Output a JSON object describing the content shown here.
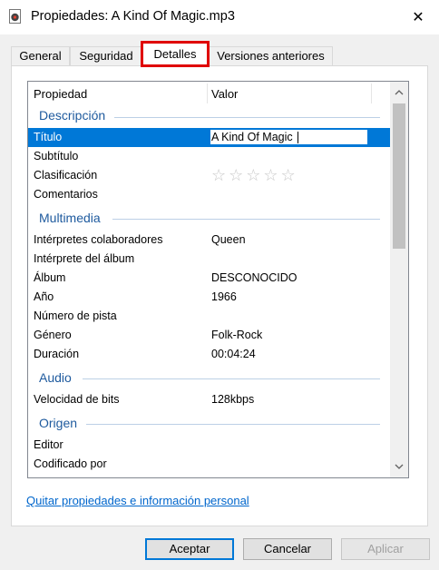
{
  "window": {
    "title": "Propiedades: A Kind Of Magic.mp3",
    "close_glyph": "✕"
  },
  "tabs": [
    {
      "label": "General"
    },
    {
      "label": "Seguridad"
    },
    {
      "label": "Detalles"
    },
    {
      "label": "Versiones anteriores"
    }
  ],
  "active_tab": "Detalles",
  "highlight_color": "#e00000",
  "list": {
    "headers": {
      "property": "Propiedad",
      "value": "Valor"
    },
    "sections": {
      "descripcion": "Descripción",
      "multimedia": "Multimedia",
      "audio": "Audio",
      "origen": "Origen"
    },
    "rows": {
      "titulo": {
        "key": "Título",
        "value": "A Kind Of Magic"
      },
      "subtitulo": {
        "key": "Subtítulo",
        "value": ""
      },
      "clasificacion": {
        "key": "Clasificación",
        "rating": 0,
        "max_rating": 5
      },
      "comentarios": {
        "key": "Comentarios",
        "value": ""
      },
      "interpretes": {
        "key": "Intérpretes colaboradores",
        "value": "Queen"
      },
      "interprete_album": {
        "key": "Intérprete del álbum",
        "value": ""
      },
      "album": {
        "key": "Álbum",
        "value": "DESCONOCIDO"
      },
      "anio": {
        "key": "Año",
        "value": "1966"
      },
      "pista": {
        "key": "Número de pista",
        "value": ""
      },
      "genero": {
        "key": "Género",
        "value": "Folk-Rock"
      },
      "duracion": {
        "key": "Duración",
        "value": "00:04:24"
      },
      "bitrate": {
        "key": "Velocidad de bits",
        "value": "128kbps"
      },
      "editor": {
        "key": "Editor",
        "value": ""
      },
      "codificado": {
        "key": "Codificado por",
        "value": ""
      }
    },
    "stars_glyph": "☆☆☆☆☆"
  },
  "link_remove": "Quitar propiedades e información personal",
  "buttons": {
    "ok": "Aceptar",
    "cancel": "Cancelar",
    "apply": "Aplicar"
  },
  "colors": {
    "selection": "#0078d7",
    "section_heading": "#1e5a9e",
    "link": "#0066cc"
  }
}
